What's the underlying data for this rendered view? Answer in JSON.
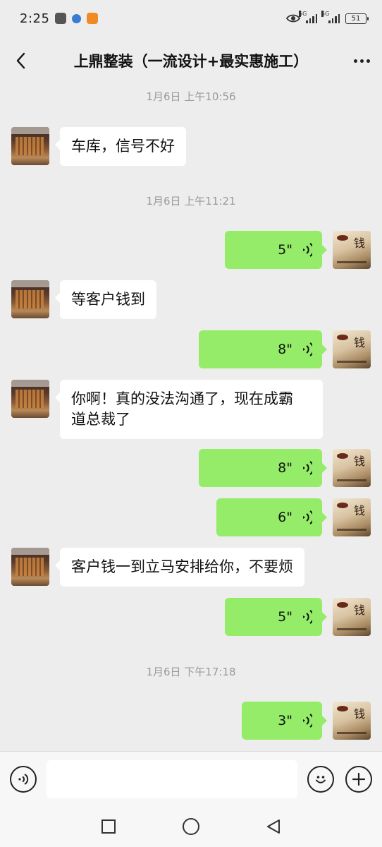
{
  "status_bar": {
    "time": "2:25",
    "network_1": "5G",
    "network_2": "5G",
    "battery": "51"
  },
  "header": {
    "title": "上鼎整装（一流设计+最实惠施工）",
    "back_icon": "chevron-left-icon",
    "more_icon": "more-horizontal-icon"
  },
  "timestamps": [
    "1月6日 上午10:56",
    "1月6日 上午11:21",
    "1月6日 下午17:18"
  ],
  "messages": [
    {
      "side": "in",
      "type": "text",
      "text": "车库，信号不好"
    },
    {
      "side": "out",
      "type": "voice",
      "duration": "5\""
    },
    {
      "side": "in",
      "type": "text",
      "text": "等客户钱到"
    },
    {
      "side": "out",
      "type": "voice",
      "duration": "8\""
    },
    {
      "side": "in",
      "type": "text",
      "line1": "你啊！真的没法沟通了，现在成霸",
      "line2": "道总裁了"
    },
    {
      "side": "out",
      "type": "voice",
      "duration": "8\""
    },
    {
      "side": "out",
      "type": "voice",
      "duration": "6\""
    },
    {
      "side": "in",
      "type": "text",
      "text": "客户钱一到立马安排给你，不要烦"
    },
    {
      "side": "out",
      "type": "voice",
      "duration": "5\""
    },
    {
      "side": "out",
      "type": "voice",
      "duration": "3\""
    }
  ],
  "self_avatar_glyph": "钱",
  "input_bar": {
    "voice_icon": "voice-input-icon",
    "emoji_icon": "emoji-icon",
    "plus_icon": "plus-icon"
  },
  "nav_bar": {
    "recents_icon": "square-icon",
    "home_icon": "circle-icon",
    "back_icon": "triangle-back-icon"
  }
}
